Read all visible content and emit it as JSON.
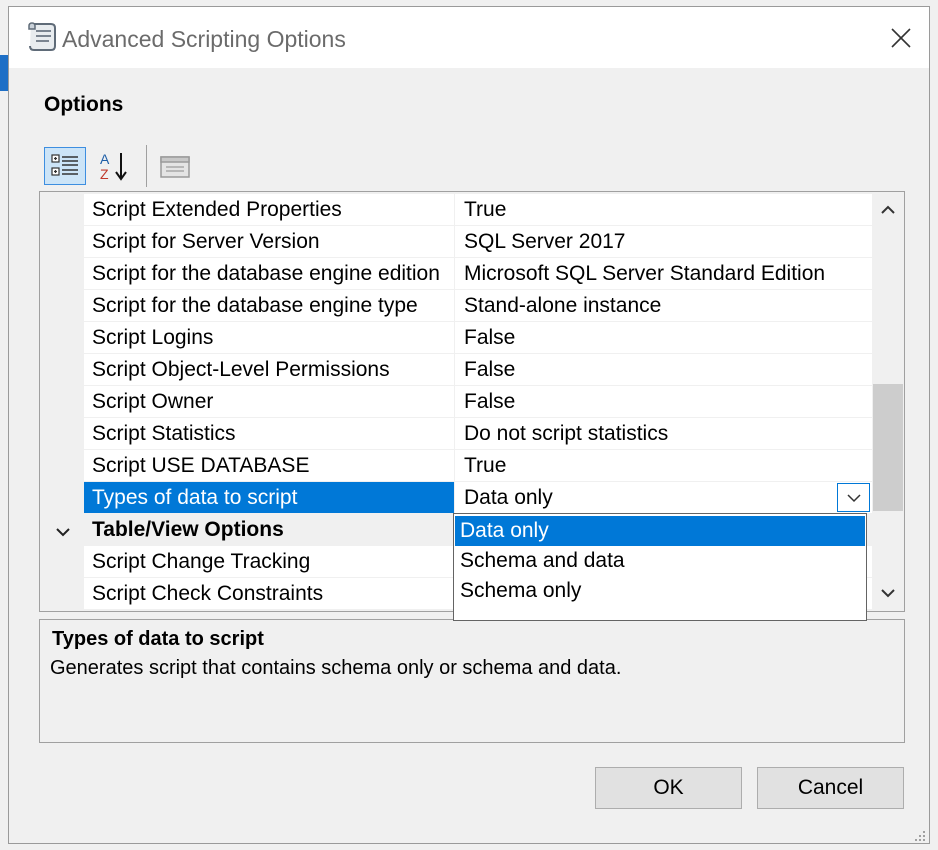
{
  "window": {
    "title": "Advanced Scripting Options",
    "close_icon": "close-icon",
    "app_icon": "scroll-icon"
  },
  "options_label": "Options",
  "toolbar": {
    "categorized_icon": "categorized-view-icon",
    "alphabetical_icon": "sort-alphabetical-icon",
    "property_pages_icon": "property-pages-icon"
  },
  "properties": [
    {
      "name": "Script Extended Properties",
      "value": "True"
    },
    {
      "name": "Script for Server Version",
      "value": "SQL Server 2017"
    },
    {
      "name": "Script for the database engine edition",
      "value": "Microsoft SQL Server Standard Edition"
    },
    {
      "name": "Script for the database engine type",
      "value": "Stand-alone instance"
    },
    {
      "name": "Script Logins",
      "value": "False"
    },
    {
      "name": "Script Object-Level Permissions",
      "value": "False"
    },
    {
      "name": "Script Owner",
      "value": "False"
    },
    {
      "name": "Script Statistics",
      "value": "Do not script statistics"
    },
    {
      "name": "Script USE DATABASE",
      "value": "True"
    },
    {
      "name": "Types of data to script",
      "value": "Data only"
    }
  ],
  "category": {
    "label": "Table/View Options",
    "chevron_icon": "chevron-down-icon"
  },
  "category_properties": [
    {
      "name": "Script Change Tracking",
      "value": ""
    },
    {
      "name": "Script Check Constraints",
      "value": ""
    }
  ],
  "dropdown": {
    "options": [
      "Data only",
      "Schema and data",
      "Schema only"
    ],
    "selected": "Data only"
  },
  "description": {
    "title": "Types of data to script",
    "text": "Generates script that contains schema only or schema and data."
  },
  "buttons": {
    "ok": "OK",
    "cancel": "Cancel"
  },
  "colors": {
    "selection": "#0078d7",
    "dialog_bg": "#f0f0f0"
  }
}
